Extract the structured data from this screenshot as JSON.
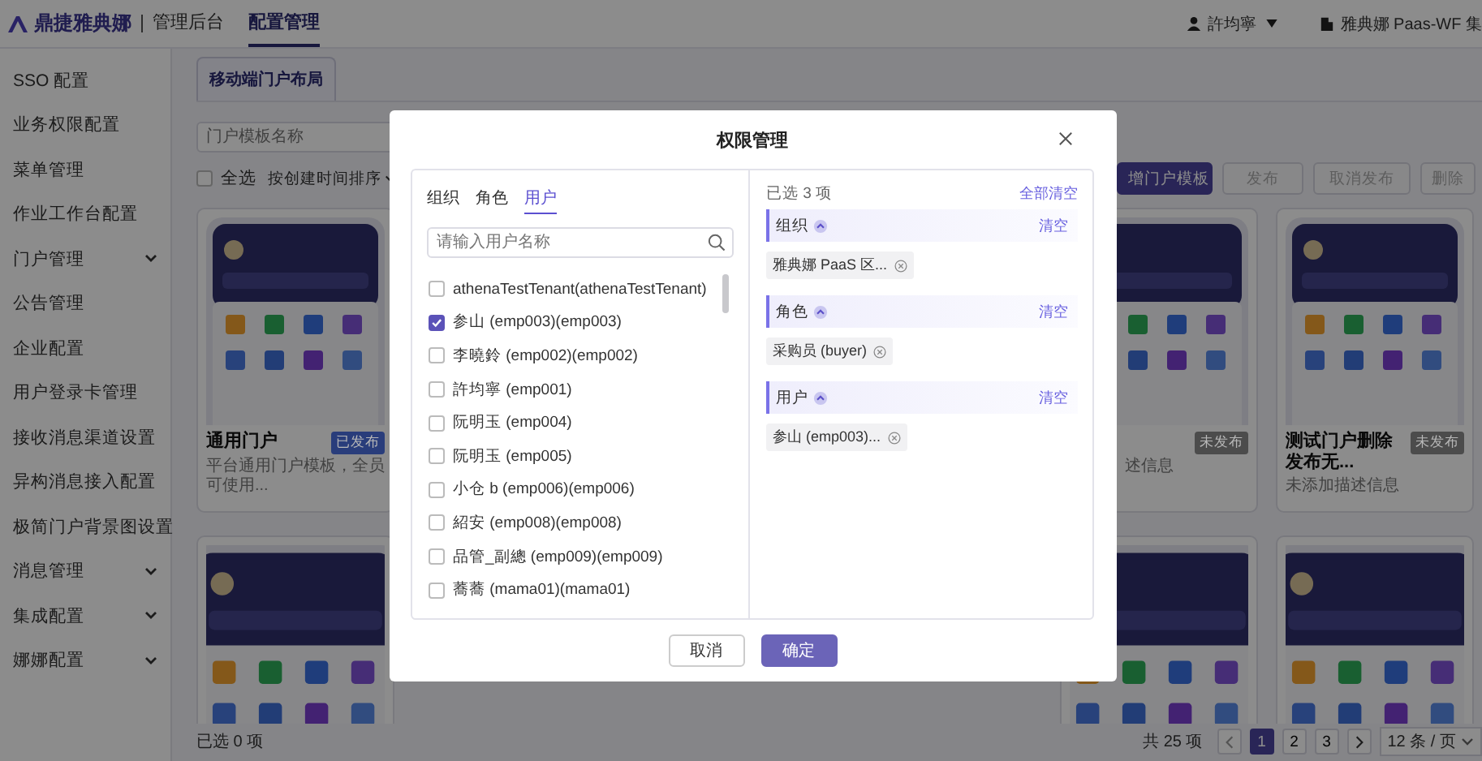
{
  "header": {
    "logo": "鼎捷雅典娜",
    "app_name": "管理后台",
    "nav": [
      {
        "label": "配置管理",
        "selected": true
      }
    ],
    "user": "許均寧",
    "tenant": "雅典娜 Paas-WF 集"
  },
  "sidebar": {
    "items": [
      {
        "label": "SSO 配置",
        "kind": "link"
      },
      {
        "label": "业务权限配置",
        "kind": "link"
      },
      {
        "label": "菜单管理",
        "kind": "link"
      },
      {
        "label": "作业工作台配置",
        "kind": "link"
      },
      {
        "label": "门户管理",
        "kind": "group",
        "expanded": false
      },
      {
        "label": "公告管理",
        "kind": "link"
      },
      {
        "label": "企业配置",
        "kind": "link"
      },
      {
        "label": "用户登录卡管理",
        "kind": "link"
      },
      {
        "label": "接收消息渠道设置",
        "kind": "link"
      },
      {
        "label": "异构消息接入配置",
        "kind": "link"
      },
      {
        "label": "极简门户背景图设置",
        "kind": "link"
      },
      {
        "label": "消息管理",
        "kind": "group",
        "expanded": false
      },
      {
        "label": "集成配置",
        "kind": "group",
        "expanded": false
      },
      {
        "label": "娜娜配置",
        "kind": "group",
        "expanded": false
      }
    ]
  },
  "tabs": [
    {
      "label": "移动端门户布局",
      "selected": true
    }
  ],
  "search": {
    "placeholder": "门户模板名称"
  },
  "toolbar": {
    "select_all": {
      "label": "全选",
      "checked": false
    },
    "sort": "按创建时间排序",
    "buttons": [
      {
        "label": "增门户模板",
        "kind": "primary",
        "disabled": false
      },
      {
        "label": "发布",
        "kind": "default",
        "disabled": true
      },
      {
        "label": "取消发布",
        "kind": "default",
        "disabled": true
      },
      {
        "label": "删除",
        "kind": "default",
        "disabled": true
      }
    ]
  },
  "cards": [
    {
      "kind": "full",
      "title": "通用门户",
      "badge": "已发布",
      "color": "#293d7b",
      "desc": "平台通用门户模板，全员可使用..."
    },
    {
      "kind": "partial",
      "badge": "未发布",
      "color": "#4c4c4c",
      "desc": "述信息"
    },
    {
      "kind": "full",
      "title": "测试门户删除发布无...",
      "badge": "未发布",
      "color": "#4c4c4c",
      "desc": "未添加描述信息"
    },
    {
      "kind": "picture"
    },
    {
      "kind": "picture"
    },
    {
      "kind": "picture"
    }
  ],
  "footer": {
    "selected": "已选 0 项",
    "total": "共 25 项",
    "pages": [
      {
        "label": "1",
        "selected": true
      },
      {
        "label": "2",
        "selected": false
      },
      {
        "label": "3",
        "selected": false
      }
    ],
    "page_size": "12 条 / 页"
  },
  "dialog": {
    "title": "权限管理",
    "tabs": [
      {
        "label": "组织",
        "selected": false
      },
      {
        "label": "角色",
        "selected": false
      },
      {
        "label": "用户",
        "selected": true
      }
    ],
    "search_placeholder": "请输入用户名称",
    "users": [
      {
        "label": "athenaTestTenant(athenaTestTenant)",
        "checked": false
      },
      {
        "label": "参山 (emp003)(emp003)",
        "checked": true
      },
      {
        "label": "李曉鈴 (emp002)(emp002)",
        "checked": false
      },
      {
        "label": "許均寧 (emp001)",
        "checked": false
      },
      {
        "label": "阮明玉 (emp004)",
        "checked": false
      },
      {
        "label": "阮明玉 (emp005)",
        "checked": false
      },
      {
        "label": "小仓 b (emp006)(emp006)",
        "checked": false
      },
      {
        "label": "紹安 (emp008)(emp008)",
        "checked": false
      },
      {
        "label": "品管_副總 (emp009)(emp009)",
        "checked": false
      },
      {
        "label": "蕎蕎 (mama01)(mama01)",
        "checked": false
      }
    ],
    "summary": "已选 3 项",
    "clear_all": "全部清空",
    "groups": [
      {
        "title": "组织",
        "expanded": true,
        "clear": "清空",
        "chips": [
          "雅典娜 PaaS 区..."
        ]
      },
      {
        "title": "角色",
        "expanded": true,
        "clear": "清空",
        "chips": [
          "采购员 (buyer)"
        ]
      },
      {
        "title": "用户",
        "expanded": true,
        "clear": "清空",
        "chips": [
          "参山 (emp003)..."
        ]
      }
    ],
    "buttons": [
      {
        "label": "取消",
        "kind": "default"
      },
      {
        "label": "确定",
        "kind": "primary"
      }
    ]
  }
}
